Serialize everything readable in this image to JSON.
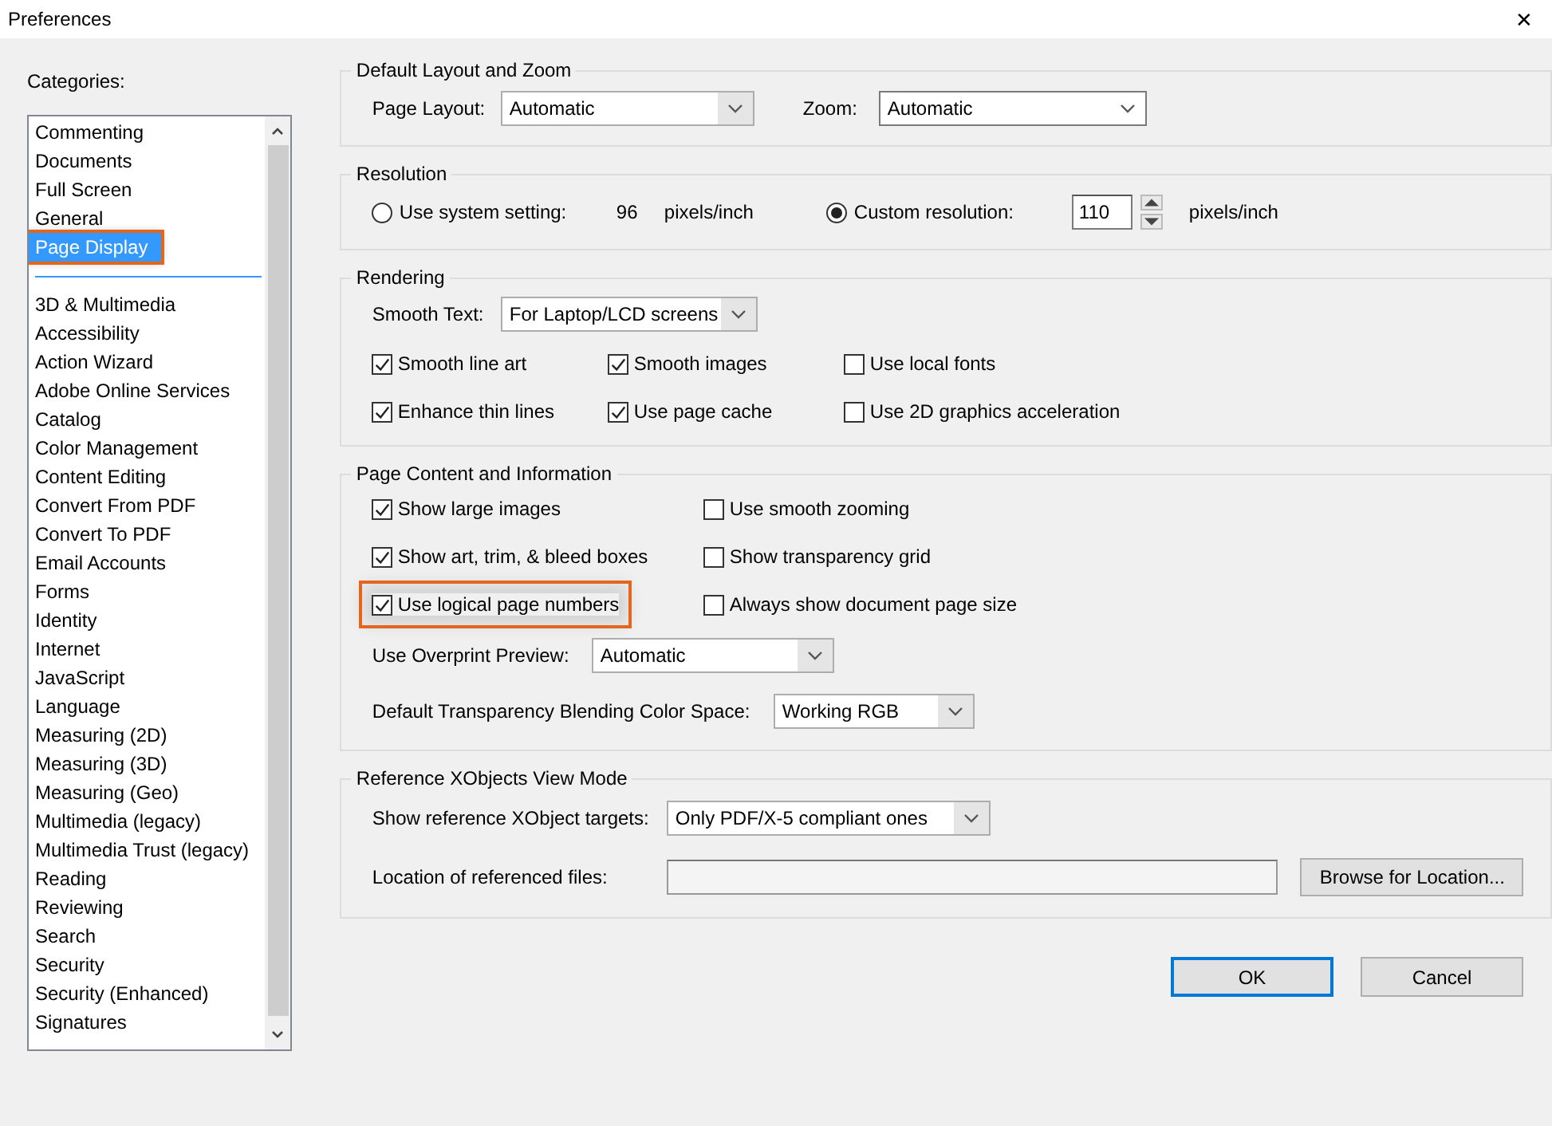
{
  "window": {
    "title": "Preferences",
    "close": "✕"
  },
  "categories": {
    "label": "Categories:",
    "groups": [
      [
        {
          "label": "Commenting",
          "selected": false,
          "highlighted": false
        },
        {
          "label": "Documents",
          "selected": false,
          "highlighted": false
        },
        {
          "label": "Full Screen",
          "selected": false,
          "highlighted": false
        },
        {
          "label": "General",
          "selected": false,
          "highlighted": false
        },
        {
          "label": "Page Display",
          "selected": true,
          "highlighted": true
        }
      ],
      [
        {
          "label": "3D & Multimedia",
          "selected": false,
          "highlighted": false
        },
        {
          "label": "Accessibility",
          "selected": false,
          "highlighted": false
        },
        {
          "label": "Action Wizard",
          "selected": false,
          "highlighted": false
        },
        {
          "label": "Adobe Online Services",
          "selected": false,
          "highlighted": false
        },
        {
          "label": "Catalog",
          "selected": false,
          "highlighted": false
        },
        {
          "label": "Color Management",
          "selected": false,
          "highlighted": false
        },
        {
          "label": "Content Editing",
          "selected": false,
          "highlighted": false
        },
        {
          "label": "Convert From PDF",
          "selected": false,
          "highlighted": false
        },
        {
          "label": "Convert To PDF",
          "selected": false,
          "highlighted": false
        },
        {
          "label": "Email Accounts",
          "selected": false,
          "highlighted": false
        },
        {
          "label": "Forms",
          "selected": false,
          "highlighted": false
        },
        {
          "label": "Identity",
          "selected": false,
          "highlighted": false
        },
        {
          "label": "Internet",
          "selected": false,
          "highlighted": false
        },
        {
          "label": "JavaScript",
          "selected": false,
          "highlighted": false
        },
        {
          "label": "Language",
          "selected": false,
          "highlighted": false
        },
        {
          "label": "Measuring (2D)",
          "selected": false,
          "highlighted": false
        },
        {
          "label": "Measuring (3D)",
          "selected": false,
          "highlighted": false
        },
        {
          "label": "Measuring (Geo)",
          "selected": false,
          "highlighted": false
        },
        {
          "label": "Multimedia (legacy)",
          "selected": false,
          "highlighted": false
        },
        {
          "label": "Multimedia Trust (legacy)",
          "selected": false,
          "highlighted": false
        },
        {
          "label": "Reading",
          "selected": false,
          "highlighted": false
        },
        {
          "label": "Reviewing",
          "selected": false,
          "highlighted": false
        },
        {
          "label": "Search",
          "selected": false,
          "highlighted": false
        },
        {
          "label": "Security",
          "selected": false,
          "highlighted": false
        },
        {
          "label": "Security (Enhanced)",
          "selected": false,
          "highlighted": false
        },
        {
          "label": "Signatures",
          "selected": false,
          "highlighted": false
        }
      ]
    ]
  },
  "sections": [
    {
      "title": "Default Layout and Zoom",
      "rows": [
        [
          {
            "kind": "label",
            "text": "Page Layout:"
          },
          {
            "kind": "dropdown",
            "value": "Automatic",
            "focused": false
          },
          {
            "kind": "label",
            "text": "Zoom:"
          },
          {
            "kind": "dropdown",
            "value": "Automatic",
            "focused": true
          }
        ]
      ]
    },
    {
      "title": "Resolution",
      "rows": [
        [
          {
            "kind": "radio",
            "text": "Use system setting:",
            "selected": false
          },
          {
            "kind": "label",
            "text": "96"
          },
          {
            "kind": "label",
            "text": "pixels/inch"
          },
          {
            "kind": "radio",
            "text": "Custom resolution:",
            "selected": true
          },
          {
            "kind": "spin",
            "value": "110"
          },
          {
            "kind": "label",
            "text": "pixels/inch"
          }
        ]
      ]
    },
    {
      "title": "Rendering",
      "rows": [
        [
          {
            "kind": "label",
            "text": "Smooth Text:"
          },
          {
            "kind": "dropdown",
            "value": "For Laptop/LCD screens",
            "focused": false
          }
        ],
        [
          {
            "kind": "checkbox",
            "text": "Smooth line art",
            "checked": true,
            "highlighted": false
          },
          {
            "kind": "checkbox",
            "text": "Smooth images",
            "checked": true,
            "highlighted": false
          },
          {
            "kind": "checkbox",
            "text": "Use local fonts",
            "checked": false,
            "highlighted": false
          }
        ],
        [
          {
            "kind": "checkbox",
            "text": "Enhance thin lines",
            "checked": true,
            "highlighted": false
          },
          {
            "kind": "checkbox",
            "text": "Use page cache",
            "checked": true,
            "highlighted": false
          },
          {
            "kind": "checkbox",
            "text": "Use 2D graphics acceleration",
            "checked": false,
            "highlighted": false
          }
        ]
      ]
    },
    {
      "title": "Page Content and Information",
      "rows": [
        [
          {
            "kind": "checkbox",
            "text": "Show large images",
            "checked": true,
            "highlighted": false
          },
          {
            "kind": "checkbox",
            "text": "Use smooth zooming",
            "checked": false,
            "highlighted": false
          }
        ],
        [
          {
            "kind": "checkbox",
            "text": "Show art, trim, & bleed boxes",
            "checked": true,
            "highlighted": false
          },
          {
            "kind": "checkbox",
            "text": "Show transparency grid",
            "checked": false,
            "highlighted": false
          }
        ],
        [
          {
            "kind": "checkbox",
            "text": "Use logical page numbers",
            "checked": true,
            "highlighted": true
          },
          {
            "kind": "checkbox",
            "text": "Always show document page size",
            "checked": false,
            "highlighted": false
          }
        ],
        [
          {
            "kind": "label",
            "text": "Use Overprint Preview:"
          },
          {
            "kind": "dropdown",
            "value": "Automatic",
            "focused": false
          }
        ],
        [
          {
            "kind": "label",
            "text": "Default Transparency Blending Color Space:"
          },
          {
            "kind": "dropdown",
            "value": "Working RGB",
            "focused": false
          }
        ]
      ]
    },
    {
      "title": "Reference XObjects View Mode",
      "rows": [
        [
          {
            "kind": "label",
            "text": "Show reference XObject targets:"
          },
          {
            "kind": "dropdown",
            "value": "Only PDF/X-5 compliant ones",
            "focused": false
          }
        ],
        [
          {
            "kind": "label",
            "text": "Location of referenced files:"
          },
          {
            "kind": "field"
          },
          {
            "kind": "button",
            "text": "Browse for Location..."
          }
        ]
      ]
    }
  ],
  "buttons": [
    {
      "label": "OK",
      "default": true
    },
    {
      "label": "Cancel",
      "default": false
    }
  ]
}
